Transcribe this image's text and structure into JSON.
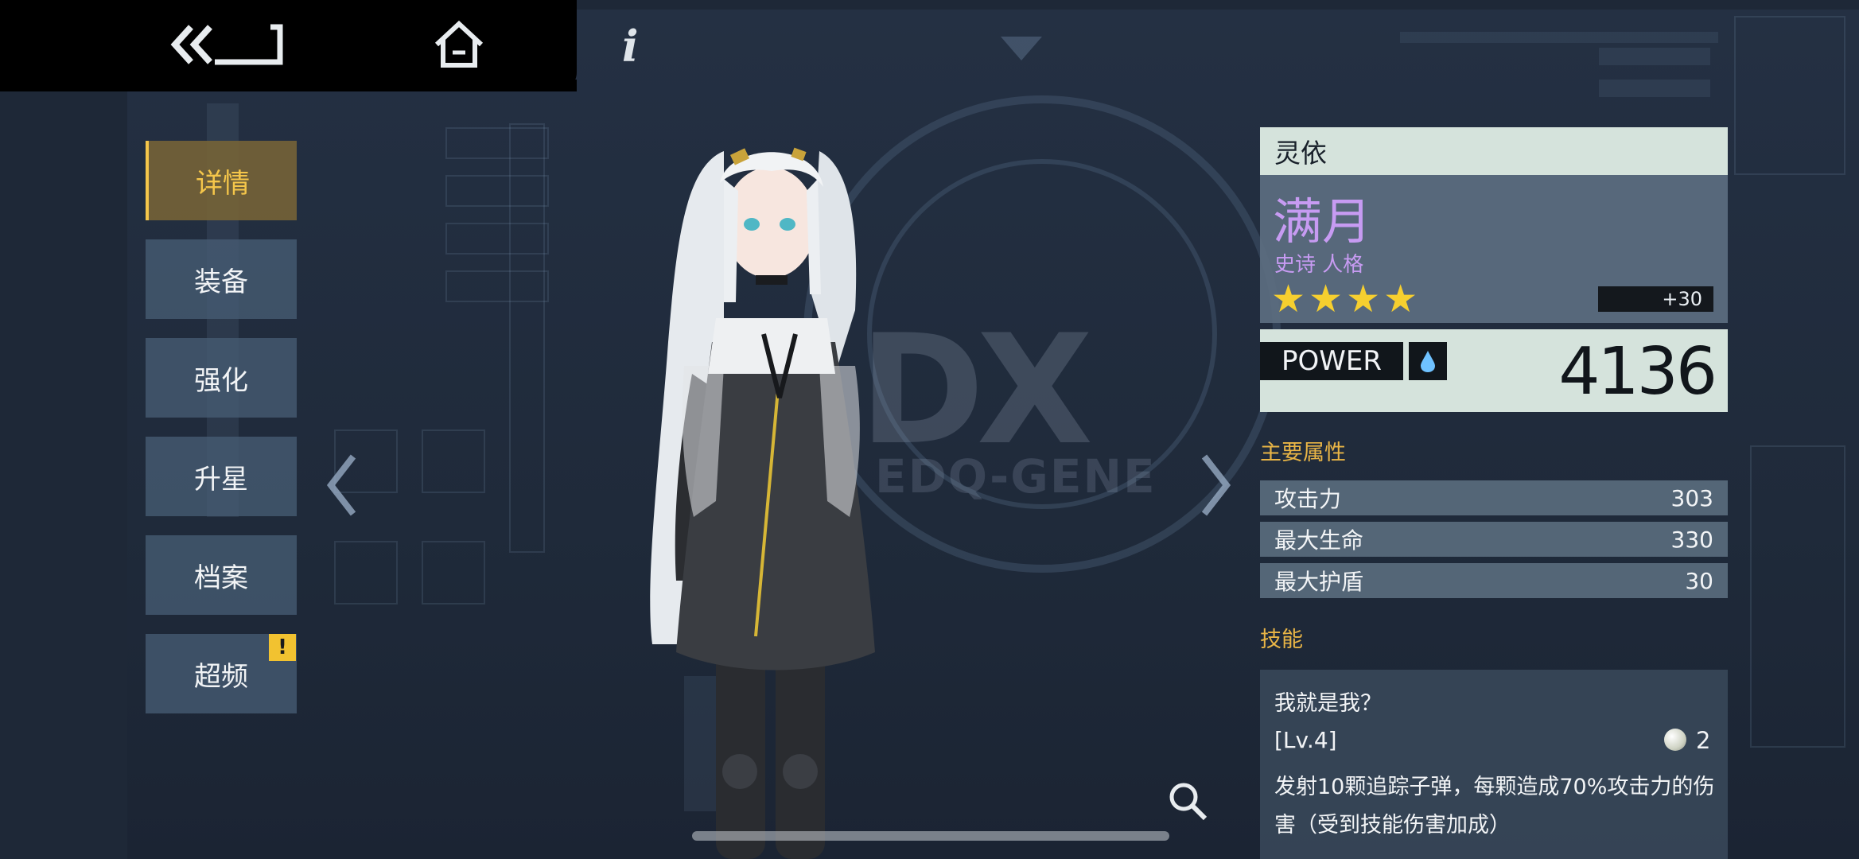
{
  "nav": {
    "items": [
      {
        "label": "详情"
      },
      {
        "label": "装备"
      },
      {
        "label": "强化"
      },
      {
        "label": "升星"
      },
      {
        "label": "档案"
      },
      {
        "label": "超频"
      }
    ],
    "alert_badge": "!"
  },
  "background": {
    "logo_text": "DX",
    "logo_sub": "EDQ-GENE"
  },
  "info_icon": "i",
  "character": {
    "name": "灵依",
    "persona": "满月",
    "rarity": "史诗 人格",
    "stars": "★★★★",
    "star_count": 4,
    "bonus": "+30",
    "power_label": "POWER",
    "power": "4136"
  },
  "attributes": {
    "title": "主要属性",
    "rows": [
      {
        "label": "攻击力",
        "value": "303"
      },
      {
        "label": "最大生命",
        "value": "330"
      },
      {
        "label": "最大护盾",
        "value": "30"
      }
    ]
  },
  "skills": {
    "title": "技能",
    "name": "我就是我？",
    "level": "[Lv.4]",
    "cost": "2",
    "description": "发射10颗追踪子弹，每颗造成70%攻击力的伤害（受到技能伤害加成）"
  },
  "colors": {
    "accent_gold": "#f5c64a",
    "persona_purple": "#c79bf2",
    "panel_mint": "#d5e3dc",
    "star_yellow": "#f6cf2f"
  },
  "icons": [
    "back-icon",
    "home-icon",
    "info-icon",
    "water-element-icon",
    "magnify-icon",
    "chevron-left-icon",
    "chevron-right-icon"
  ]
}
